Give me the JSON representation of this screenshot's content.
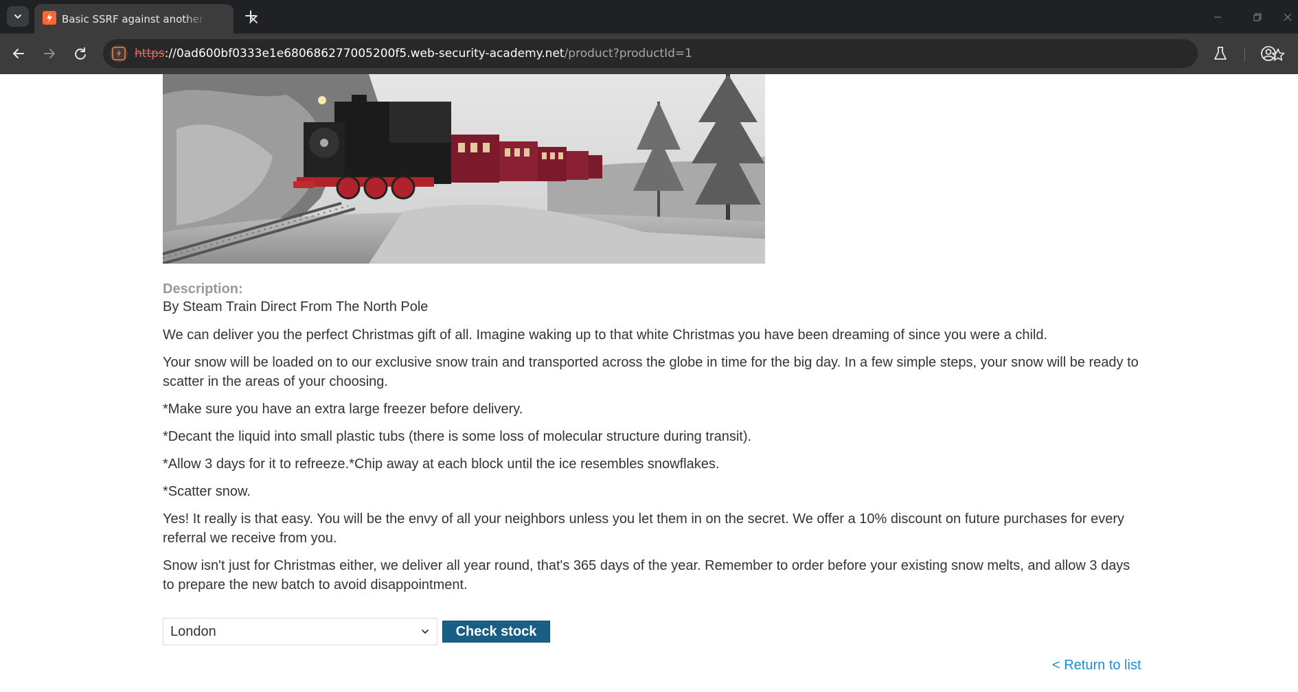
{
  "browser": {
    "tab_title": "Basic SSRF against another back-end system",
    "url_scheme": "https",
    "url_host": "://0ad600bf0333e1e680686277005200f5.web-security-academy.net",
    "url_path": "/product?productId=1",
    "accent_color": "#ff6633"
  },
  "product": {
    "image_alt": "steam-train-icon",
    "description_label": "Description:",
    "name": "By Steam Train Direct From The North Pole",
    "paragraphs": [
      "We can deliver you the perfect Christmas gift of all. Imagine waking up to that white Christmas you have been dreaming of since you were a child.",
      "Your snow will be loaded on to our exclusive snow train and transported across the globe in time for the big day. In a few simple steps, your snow will be ready to scatter in the areas of your choosing.",
      "*Make sure you have an extra large freezer before delivery.",
      "*Decant the liquid into small plastic tubs (there is some loss of molecular structure during transit).",
      "*Allow 3 days for it to refreeze.*Chip away at each block until the ice resembles snowflakes.",
      "*Scatter snow.",
      "Yes! It really is that easy. You will be the envy of all your neighbors unless you let them in on the secret. We offer a 10% discount on future purchases for every referral we receive from you.",
      "Snow isn't just for Christmas either, we deliver all year round, that's 365 days of the year. Remember to order before your existing snow melts, and allow 3 days to prepare the new batch to avoid disappointment."
    ]
  },
  "stock": {
    "selected_store": "London",
    "check_label": "Check stock",
    "button_color": "#185e85"
  },
  "nav": {
    "return_label": "< Return to list",
    "link_color": "#1a8cd8"
  }
}
